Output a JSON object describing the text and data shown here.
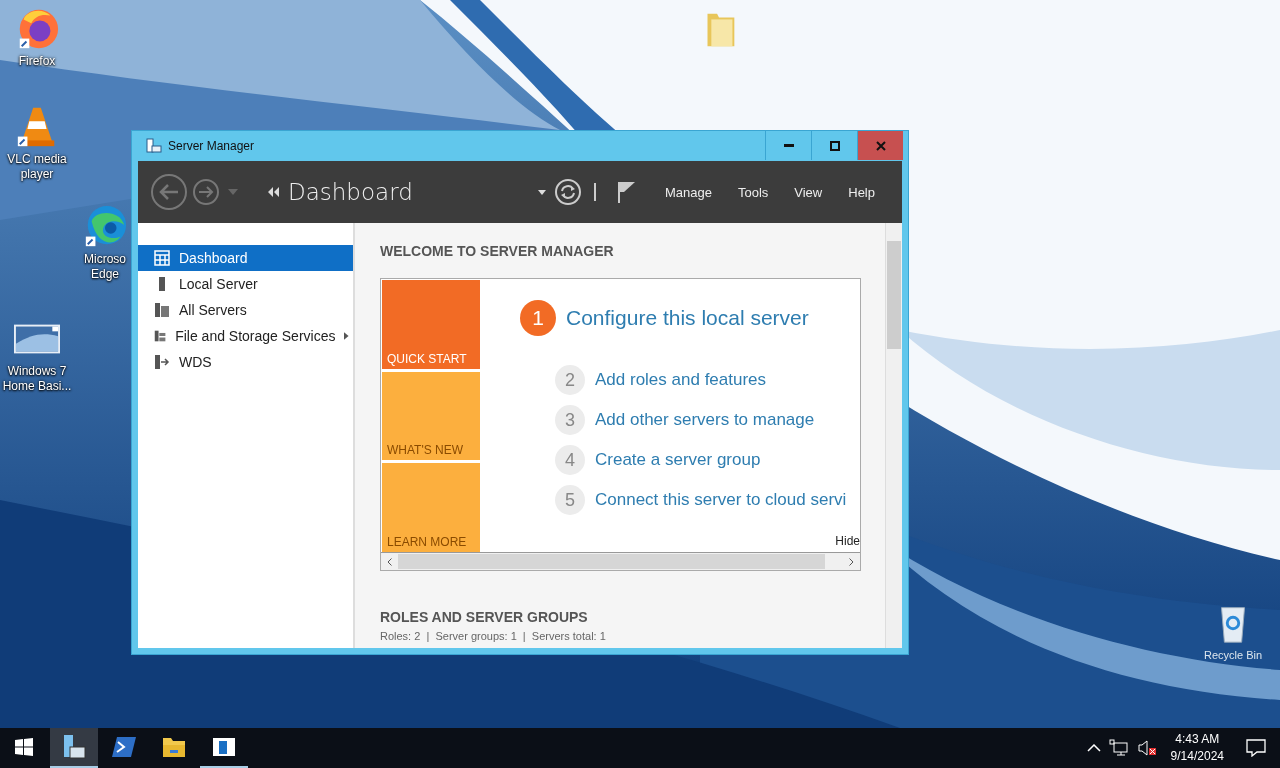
{
  "desktop": {
    "icons": [
      {
        "kind": "firefox",
        "lines": [
          "Firefox"
        ]
      },
      {
        "kind": "vlc",
        "lines": [
          "VLC media",
          "player"
        ]
      },
      {
        "kind": "edge",
        "lines": [
          "Microso",
          "Edge"
        ]
      },
      {
        "kind": "thumbnail",
        "lines": [
          "Windows 7",
          "Home Basi..."
        ]
      },
      {
        "kind": "folder"
      },
      {
        "kind": "recycle",
        "lines": [
          "Recycle Bin"
        ]
      }
    ]
  },
  "window": {
    "title": "Server Manager",
    "toolbar": {
      "breadcrumb": "Dashboard",
      "menu": [
        "Manage",
        "Tools",
        "View",
        "Help"
      ]
    },
    "sidebar": {
      "items": [
        {
          "label": "Dashboard",
          "kind": "dashboard",
          "selected": true,
          "expandable": false
        },
        {
          "label": "Local Server",
          "kind": "server",
          "selected": false,
          "expandable": false
        },
        {
          "label": "All Servers",
          "kind": "servers",
          "selected": false,
          "expandable": false
        },
        {
          "label": "File and Storage Services",
          "kind": "storage",
          "selected": false,
          "expandable": true
        },
        {
          "label": "WDS",
          "kind": "wds",
          "selected": false,
          "expandable": false
        }
      ]
    },
    "welcome": {
      "heading": "WELCOME TO SERVER MANAGER",
      "tiles": [
        {
          "label": "QUICK START",
          "selected": true
        },
        {
          "label": "WHAT'S NEW",
          "selected": false
        },
        {
          "label": "LEARN MORE",
          "selected": false
        }
      ],
      "steps": [
        {
          "number": "1",
          "text": "Configure this local server",
          "current": true
        },
        {
          "number": "2",
          "text": "Add roles and features",
          "current": false
        },
        {
          "number": "3",
          "text": "Add other servers to manage",
          "current": false
        },
        {
          "number": "4",
          "text": "Create a server group",
          "current": false
        },
        {
          "number": "5",
          "text": "Connect this server to cloud servi",
          "current": false
        }
      ],
      "hide": "Hide"
    },
    "roles": {
      "heading": "ROLES AND SERVER GROUPS",
      "summary": "Roles: 2  |  Server groups: 1  |  Servers total: 1"
    }
  },
  "taskbar": {
    "apps": [
      {
        "kind": "server-manager",
        "active": true,
        "running": true
      },
      {
        "kind": "powershell",
        "active": false,
        "running": false
      },
      {
        "kind": "explorer",
        "active": false,
        "running": false
      },
      {
        "kind": "app-window",
        "active": false,
        "running": true
      }
    ],
    "tray": {
      "volume_muted": true,
      "time": "4:43 AM",
      "date": "9/14/2024"
    }
  }
}
